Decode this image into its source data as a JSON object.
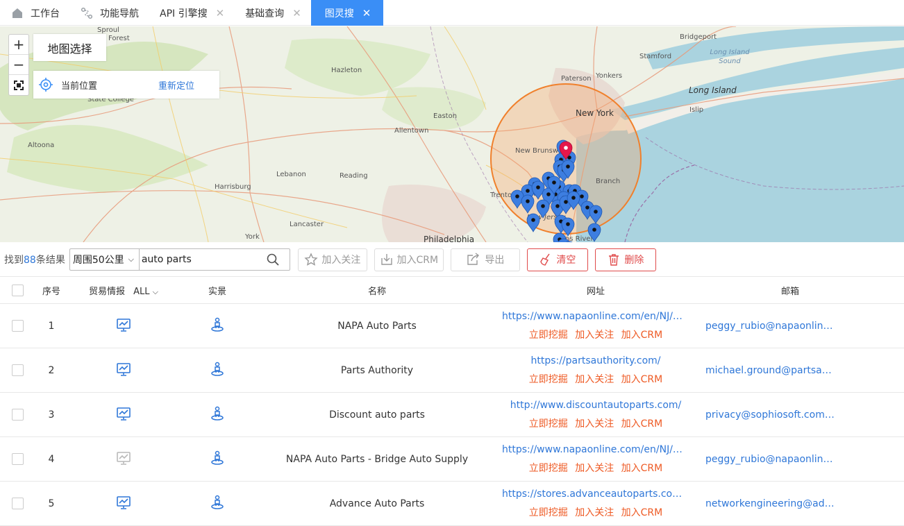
{
  "tabs": [
    {
      "label": "工作台",
      "icon": "home-icon",
      "closable": false,
      "active": false
    },
    {
      "label": "功能导航",
      "icon": "route-icon",
      "closable": false,
      "active": false
    },
    {
      "label": "API 引擎搜",
      "icon": "",
      "closable": true,
      "active": false
    },
    {
      "label": "基础查询",
      "icon": "",
      "closable": true,
      "active": false
    },
    {
      "label": "图灵搜",
      "icon": "",
      "closable": true,
      "active": true
    }
  ],
  "map": {
    "zoom_in": "+",
    "zoom_out": "−",
    "map_select_label": "地图选择",
    "current_location_label": "当前位置",
    "relocate_label": "重新定位",
    "labels": [
      {
        "text": "Sproul",
        "kind": "small"
      },
      {
        "text": "Forest",
        "kind": "small"
      },
      {
        "text": "Hazleton",
        "kind": "small"
      },
      {
        "text": "State College",
        "kind": "small"
      },
      {
        "text": "Altoona",
        "kind": "small"
      },
      {
        "text": "Allentown",
        "kind": "small"
      },
      {
        "text": "Easton",
        "kind": "small"
      },
      {
        "text": "Lebanon",
        "kind": "small"
      },
      {
        "text": "Reading",
        "kind": "small"
      },
      {
        "text": "Harrisburg",
        "kind": "small"
      },
      {
        "text": "Lancaster",
        "kind": "small"
      },
      {
        "text": "York",
        "kind": "small"
      },
      {
        "text": "Philadelphia",
        "kind": "city"
      },
      {
        "text": "Trenton",
        "kind": "small"
      },
      {
        "text": "New Jersey",
        "kind": "small"
      },
      {
        "text": "Toms River",
        "kind": "small"
      },
      {
        "text": "Branch",
        "kind": "small"
      },
      {
        "text": "New Brunswick",
        "kind": "small"
      },
      {
        "text": "New York",
        "kind": "city"
      },
      {
        "text": "Paterson",
        "kind": "small"
      },
      {
        "text": "Yonkers",
        "kind": "small"
      },
      {
        "text": "Stamford",
        "kind": "small"
      },
      {
        "text": "Bridgeport",
        "kind": "small"
      },
      {
        "text": "Long Island Sound",
        "kind": "water"
      },
      {
        "text": "Long Island",
        "kind": "city"
      },
      {
        "text": "Islip",
        "kind": "small"
      }
    ]
  },
  "toolbar": {
    "found_prefix": "找到",
    "found_count": "88",
    "found_suffix": "条结果",
    "radius_select": "周围50公里",
    "search_value": "auto parts",
    "follow_label": "加入关注",
    "crm_label": "加入CRM",
    "export_label": "导出",
    "clear_label": "清空",
    "delete_label": "删除"
  },
  "table": {
    "headers": {
      "index": "序号",
      "trade": "贸易情报",
      "trade_filter": "ALL",
      "realview": "实景",
      "name": "名称",
      "url": "网址",
      "email": "邮箱"
    },
    "action_labels": [
      "立即挖掘",
      "加入关注",
      "加入CRM"
    ],
    "rows": [
      {
        "index": "1",
        "name": "NAPA Auto Parts",
        "url": "https://www.napaonline.com/en/NJ/M…",
        "email": "peggy_rubio@napaonline.…",
        "trade_active": true
      },
      {
        "index": "2",
        "name": "Parts Authority",
        "url": "https://partsauthority.com/",
        "email": "michael.ground@partsaut…",
        "trade_active": true
      },
      {
        "index": "3",
        "name": "Discount auto parts",
        "url": "http://www.discountautoparts.com/",
        "email": "privacy@sophiosoft.com,k…",
        "trade_active": true
      },
      {
        "index": "4",
        "name": "NAPA Auto Parts - Bridge Auto Supply",
        "url": "https://www.napaonline.com/en/NJ/M…",
        "email": "peggy_rubio@napaonline.…",
        "trade_active": false
      },
      {
        "index": "5",
        "name": "Advance Auto Parts",
        "url": "https://stores.advanceautoparts.com/n…",
        "email": "networkengineering@adv…",
        "trade_active": true
      }
    ]
  },
  "colors": {
    "accent": "#3a8ef6",
    "link": "#2f77d8",
    "action": "#ee5a24",
    "danger": "#e04a4a"
  }
}
